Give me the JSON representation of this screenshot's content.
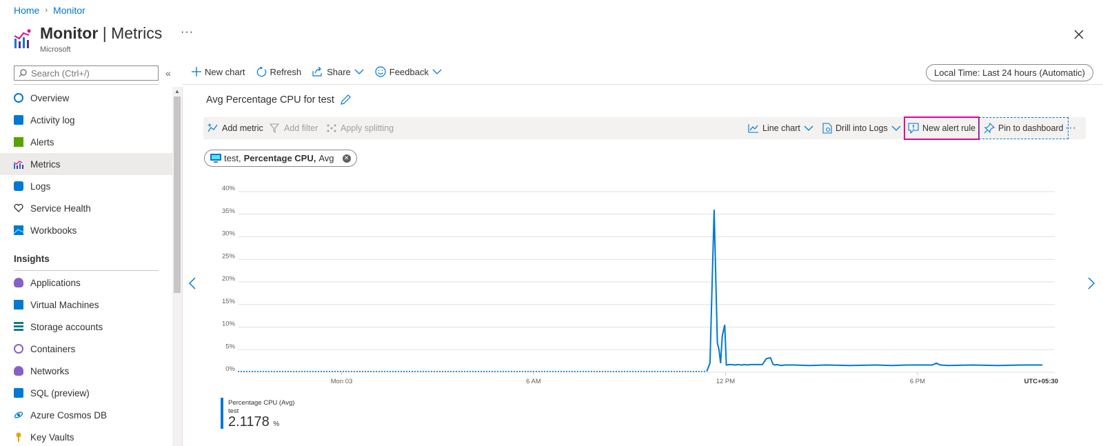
{
  "breadcrumb": {
    "home": "Home",
    "sep": "›",
    "current": "Monitor"
  },
  "header": {
    "title_main": "Monitor",
    "title_sep": " | ",
    "title_sub": "Metrics",
    "subtitle": "Microsoft",
    "more": "···",
    "close": "✕"
  },
  "sidebar": {
    "search_placeholder": "Search (Ctrl+/)",
    "collapse": "«",
    "items": [
      {
        "label": "Overview",
        "icon": "overview-icon",
        "color": "#0078d4"
      },
      {
        "label": "Activity log",
        "icon": "activity-log-icon",
        "color": "#0078d4"
      },
      {
        "label": "Alerts",
        "icon": "alerts-icon",
        "color": "#57a300"
      },
      {
        "label": "Metrics",
        "icon": "metrics-icon",
        "color": "#7719aa"
      },
      {
        "label": "Logs",
        "icon": "logs-icon",
        "color": "#0078d4"
      },
      {
        "label": "Service Health",
        "icon": "heart-icon",
        "color": "#323130"
      },
      {
        "label": "Workbooks",
        "icon": "workbooks-icon",
        "color": "#0078d4"
      }
    ],
    "insights_heading": "Insights",
    "insights": [
      {
        "label": "Applications",
        "icon": "lightbulb-icon",
        "color": "#8661c5"
      },
      {
        "label": "Virtual Machines",
        "icon": "vm-icon",
        "color": "#0078d4"
      },
      {
        "label": "Storage accounts",
        "icon": "storage-icon",
        "color": "#0e7a8c"
      },
      {
        "label": "Containers",
        "icon": "containers-icon",
        "color": "#8661c5"
      },
      {
        "label": "Networks",
        "icon": "networks-icon",
        "color": "#8661c5"
      },
      {
        "label": "SQL (preview)",
        "icon": "sql-icon",
        "color": "#0078d4"
      },
      {
        "label": "Azure Cosmos DB",
        "icon": "cosmos-icon",
        "color": "#0078d4"
      },
      {
        "label": "Key Vaults",
        "icon": "key-icon",
        "color": "#e8a400"
      }
    ]
  },
  "toolbar": {
    "new_chart": "New chart",
    "refresh": "Refresh",
    "share": "Share",
    "feedback": "Feedback",
    "time_range": "Local Time: Last 24 hours (Automatic)"
  },
  "chart_panel": {
    "title": "Avg Percentage CPU for test",
    "add_metric": "Add metric",
    "add_filter": "Add filter",
    "apply_splitting": "Apply splitting",
    "line_chart": "Line chart",
    "drill_logs": "Drill into Logs",
    "new_alert": "New alert rule",
    "pin_dashboard": "Pin to dashboard",
    "more": "···",
    "pill": {
      "resource": "test,",
      "metric": "Percentage CPU,",
      "agg": "Avg",
      "close": "✕"
    }
  },
  "chart_data": {
    "type": "line",
    "ylim": [
      0,
      40
    ],
    "yticks": [
      "0%",
      "5%",
      "10%",
      "15%",
      "20%",
      "25%",
      "30%",
      "35%",
      "40%"
    ],
    "xlabels": [
      "Mon 03",
      "6 AM",
      "12 PM",
      "6 PM"
    ],
    "xlabel_pos": [
      0.127,
      0.362,
      0.597,
      0.832
    ],
    "timezone": "UTC+05:30",
    "grid": true,
    "series": [
      {
        "name": "Percentage CPU (Avg)",
        "color": "#0078d4",
        "x": [
          0.0,
          0.574,
          0.578,
          0.583,
          0.587,
          0.589,
          0.591,
          0.593,
          0.596,
          0.598,
          0.602,
          0.605,
          0.608,
          0.612,
          0.617,
          0.62,
          0.624,
          0.627,
          0.642,
          0.647,
          0.652,
          0.655,
          0.657,
          0.66,
          0.665,
          0.67,
          0.68,
          0.7,
          0.72,
          0.75,
          0.78,
          0.8,
          0.82,
          0.85,
          0.855,
          0.86,
          0.87,
          0.9,
          0.93,
          0.96,
          0.985
        ],
        "values": [
          0.2,
          0.2,
          2,
          36,
          6.5,
          5,
          2,
          8,
          10.5,
          1.6,
          1.7,
          1.7,
          1.6,
          1.7,
          1.6,
          1.7,
          1.6,
          1.7,
          1.7,
          3,
          3.2,
          1.8,
          1.6,
          1.7,
          1.5,
          1.6,
          1.6,
          1.5,
          1.6,
          1.5,
          1.6,
          1.5,
          1.6,
          1.6,
          2,
          1.6,
          1.5,
          1.6,
          1.5,
          1.6,
          1.6
        ],
        "dashed_until": 0.574
      }
    ]
  },
  "legend": {
    "name": "Percentage CPU (Avg)",
    "resource": "test",
    "value": "2.1178",
    "unit": "%"
  }
}
